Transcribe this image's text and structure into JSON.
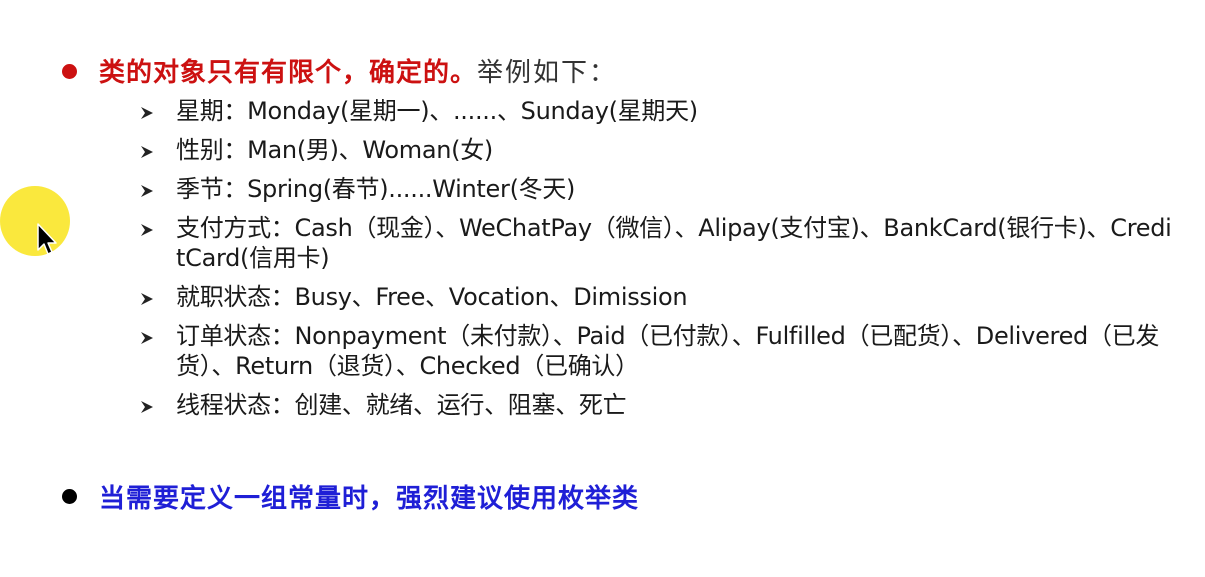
{
  "slide": {
    "bullet1": {
      "red_text": "类的对象只有有限个，确定的。",
      "tail_text": "举例如下："
    },
    "items": [
      {
        "text": "星期：Monday(星期一)、......、Sunday(星期天)"
      },
      {
        "text": "性别：Man(男)、Woman(女)"
      },
      {
        "text": "季节：Spring(春节)......Winter(冬天)"
      },
      {
        "text": "支付方式：Cash（现金）、WeChatPay（微信）、Alipay(支付宝)、BankCard(银行卡)、CreditCard(信用卡)"
      },
      {
        "text": "就职状态：Busy、Free、Vocation、Dimission"
      },
      {
        "text": "订单状态：Nonpayment（未付款）、Paid（已付款）、Fulfilled（已配货）、Delivered（已发货）、Return（退货）、Checked（已确认）"
      },
      {
        "text": "线程状态：创建、就绪、运行、阻塞、死亡"
      }
    ],
    "bullet2": {
      "blue_text": "当需要定义一组常量时，强烈建议使用枚举类"
    }
  },
  "colors": {
    "heading_red": "#cc1111",
    "heading_blue": "#1f1fd6",
    "highlight_yellow": "#fae628"
  },
  "icons": {
    "bullet": "filled-circle",
    "sub_bullet": "arrowhead-right",
    "pointer": "mouse-cursor"
  }
}
